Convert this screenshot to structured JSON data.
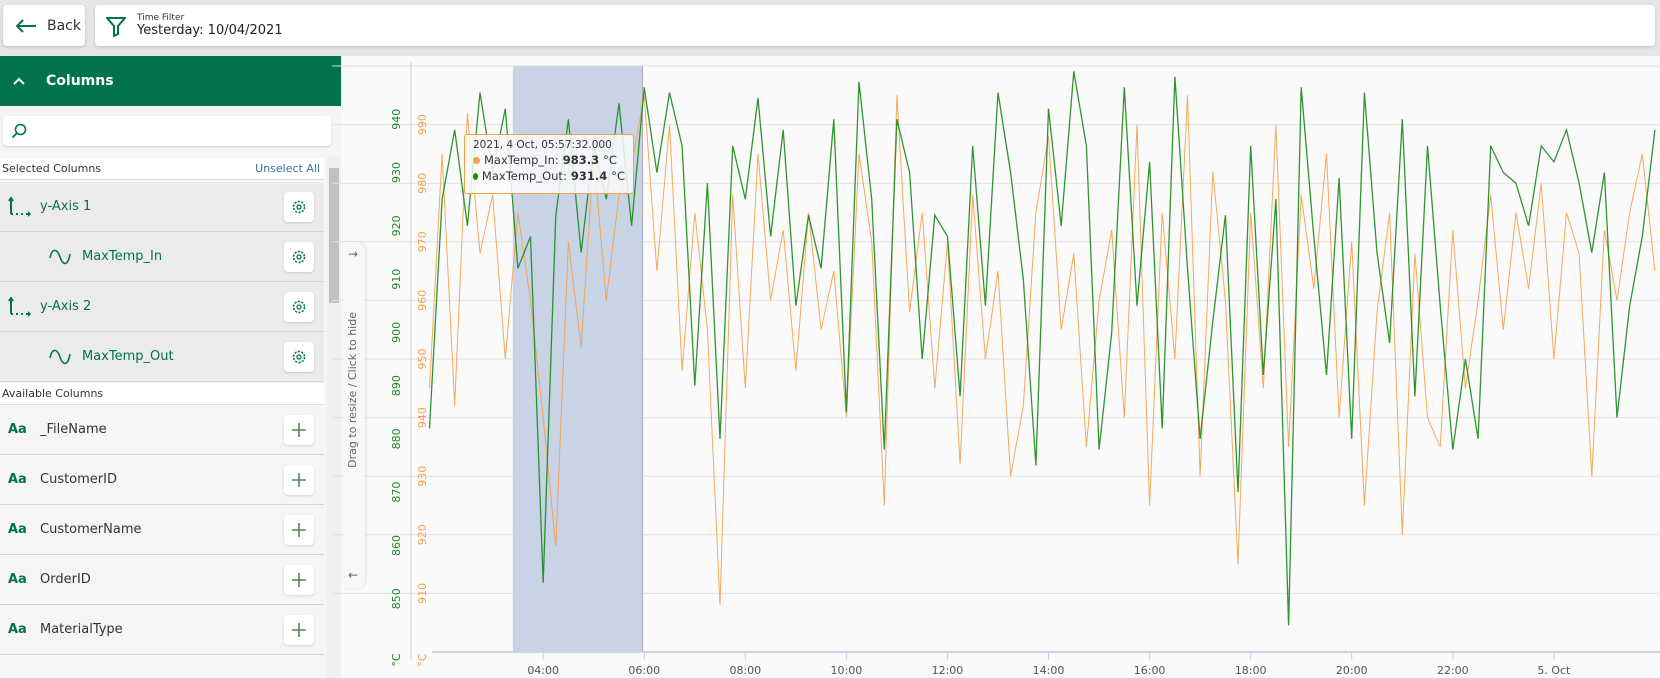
{
  "topbar": {
    "back_label": "Back",
    "filter_title": "Time Filter",
    "filter_value": "Yesterday: 10/04/2021"
  },
  "sidebar": {
    "header": "Columns",
    "search_placeholder": "",
    "selected_label": "Selected Columns",
    "unselect_all": "Unselect All",
    "selected": [
      {
        "label": "y-Axis 1",
        "type": "axis"
      },
      {
        "label": "MaxTemp_In",
        "type": "series"
      },
      {
        "label": "y-Axis 2",
        "type": "axis"
      },
      {
        "label": "MaxTemp_Out",
        "type": "series"
      }
    ],
    "available_label": "Available Columns",
    "available": [
      {
        "label": "_FileName",
        "type_icon": "Aa"
      },
      {
        "label": "CustomerID",
        "type_icon": "Aa"
      },
      {
        "label": "CustomerName",
        "type_icon": "Aa"
      },
      {
        "label": "OrderID",
        "type_icon": "Aa"
      },
      {
        "label": "MaterialType",
        "type_icon": "Aa"
      }
    ],
    "resize_hint": "Drag to resize / Click to hide"
  },
  "tooltip": {
    "time": "2021, 4 Oct, 05:57:32.000",
    "in_label": "MaxTemp_In:",
    "in_value": "983.3",
    "out_label": "MaxTemp_Out:",
    "out_value": "931.4",
    "unit": "°C"
  },
  "colors": {
    "accent": "#00734a",
    "series_in": "#f5a04a",
    "series_out": "#1a8a1a",
    "selection": "#c8d3e6"
  },
  "chart_data": {
    "type": "line",
    "x_tick_labels": [
      "04:00",
      "06:00",
      "08:00",
      "10:00",
      "12:00",
      "14:00",
      "16:00",
      "18:00",
      "20:00",
      "22:00",
      "5. Oct"
    ],
    "x_range": [
      "2021-10-04 01:48",
      "2021-10-05 02:06"
    ],
    "selection_range": [
      "2021-10-04 03:24",
      "2021-10-04 05:58"
    ],
    "grid": true,
    "y_axes": [
      {
        "series": "MaxTemp_Out",
        "unit": "°C",
        "ticks": [
          850,
          860,
          870,
          880,
          890,
          900,
          910,
          920,
          930,
          940
        ],
        "range": [
          840,
          950
        ],
        "color": "#1a8a1a"
      },
      {
        "series": "MaxTemp_In",
        "unit": "°C",
        "ticks": [
          910,
          920,
          930,
          940,
          950,
          960,
          970,
          980,
          990
        ],
        "range": [
          900,
          1000
        ],
        "color": "#f5a04a"
      }
    ],
    "x": [
      "2021-10-04 01:45",
      "2021-10-04 02:00",
      "2021-10-04 02:15",
      "2021-10-04 02:30",
      "2021-10-04 02:45",
      "2021-10-04 03:00",
      "2021-10-04 03:15",
      "2021-10-04 03:30",
      "2021-10-04 03:45",
      "2021-10-04 04:00",
      "2021-10-04 04:15",
      "2021-10-04 04:30",
      "2021-10-04 04:45",
      "2021-10-04 05:00",
      "2021-10-04 05:15",
      "2021-10-04 05:30",
      "2021-10-04 05:45",
      "2021-10-04 06:00",
      "2021-10-04 06:15",
      "2021-10-04 06:30",
      "2021-10-04 06:45",
      "2021-10-04 07:00",
      "2021-10-04 07:15",
      "2021-10-04 07:30",
      "2021-10-04 07:45",
      "2021-10-04 08:00",
      "2021-10-04 08:15",
      "2021-10-04 08:30",
      "2021-10-04 08:45",
      "2021-10-04 09:00",
      "2021-10-04 09:15",
      "2021-10-04 09:30",
      "2021-10-04 09:45",
      "2021-10-04 10:00",
      "2021-10-04 10:15",
      "2021-10-04 10:30",
      "2021-10-04 10:45",
      "2021-10-04 11:00",
      "2021-10-04 11:15",
      "2021-10-04 11:30",
      "2021-10-04 11:45",
      "2021-10-04 12:00",
      "2021-10-04 12:15",
      "2021-10-04 12:30",
      "2021-10-04 12:45",
      "2021-10-04 13:00",
      "2021-10-04 13:15",
      "2021-10-04 13:30",
      "2021-10-04 13:45",
      "2021-10-04 14:00",
      "2021-10-04 14:15",
      "2021-10-04 14:30",
      "2021-10-04 14:45",
      "2021-10-04 15:00",
      "2021-10-04 15:15",
      "2021-10-04 15:30",
      "2021-10-04 15:45",
      "2021-10-04 16:00",
      "2021-10-04 16:15",
      "2021-10-04 16:30",
      "2021-10-04 16:45",
      "2021-10-04 17:00",
      "2021-10-04 17:15",
      "2021-10-04 17:30",
      "2021-10-04 17:45",
      "2021-10-04 18:00",
      "2021-10-04 18:15",
      "2021-10-04 18:30",
      "2021-10-04 18:45",
      "2021-10-04 19:00",
      "2021-10-04 19:15",
      "2021-10-04 19:30",
      "2021-10-04 19:45",
      "2021-10-04 20:00",
      "2021-10-04 20:15",
      "2021-10-04 20:30",
      "2021-10-04 20:45",
      "2021-10-04 21:00",
      "2021-10-04 21:15",
      "2021-10-04 21:30",
      "2021-10-04 21:45",
      "2021-10-04 22:00",
      "2021-10-04 22:15",
      "2021-10-04 22:30",
      "2021-10-04 22:45",
      "2021-10-04 23:00",
      "2021-10-04 23:15",
      "2021-10-04 23:30",
      "2021-10-04 23:45",
      "2021-10-05 00:00",
      "2021-10-05 00:15",
      "2021-10-05 00:30",
      "2021-10-05 00:45",
      "2021-10-05 01:00",
      "2021-10-05 01:15",
      "2021-10-05 01:30",
      "2021-10-05 01:45",
      "2021-10-05 02:00"
    ],
    "series": [
      {
        "name": "MaxTemp_In",
        "axis": 1,
        "values": [
          945,
          985,
          942,
          992,
          968,
          978,
          950,
          975,
          960,
          940,
          918,
          970,
          952,
          985,
          960,
          978,
          983,
          995,
          965,
          990,
          948,
          975,
          955,
          908,
          978,
          945,
          985,
          960,
          972,
          948,
          975,
          955,
          965,
          940,
          985,
          970,
          925,
          995,
          958,
          975,
          945,
          970,
          932,
          978,
          950,
          965,
          930,
          942,
          975,
          988,
          955,
          968,
          935,
          960,
          972,
          940,
          990,
          925,
          975,
          950,
          995,
          930,
          982,
          960,
          915,
          975,
          945,
          990,
          935,
          978,
          962,
          985,
          940,
          970,
          925,
          958,
          975,
          920,
          968,
          940,
          935,
          972,
          945,
          960,
          978,
          955,
          975,
          962,
          980,
          950,
          975,
          968,
          930,
          972,
          960,
          975,
          985,
          965
        ]
      },
      {
        "name": "MaxTemp_Out",
        "axis": 0,
        "values": [
          882,
          925,
          938,
          920,
          945,
          930,
          942,
          912,
          918,
          853,
          922,
          940,
          915,
          935,
          925,
          943,
          920,
          946,
          930,
          945,
          935,
          890,
          928,
          880,
          935,
          925,
          944,
          918,
          938,
          905,
          922,
          912,
          940,
          885,
          947,
          925,
          878,
          940,
          930,
          895,
          922,
          918,
          888,
          935,
          905,
          945,
          930,
          910,
          875,
          942,
          920,
          949,
          935,
          878,
          900,
          946,
          905,
          932,
          882,
          948,
          912,
          880,
          902,
          922,
          870,
          935,
          892,
          925,
          845,
          946,
          918,
          892,
          929,
          880,
          945,
          915,
          898,
          940,
          888,
          935,
          905,
          878,
          895,
          880,
          935,
          930,
          928,
          920,
          935,
          932,
          938,
          928,
          915,
          930,
          884,
          905,
          918,
          938
        ]
      }
    ]
  }
}
